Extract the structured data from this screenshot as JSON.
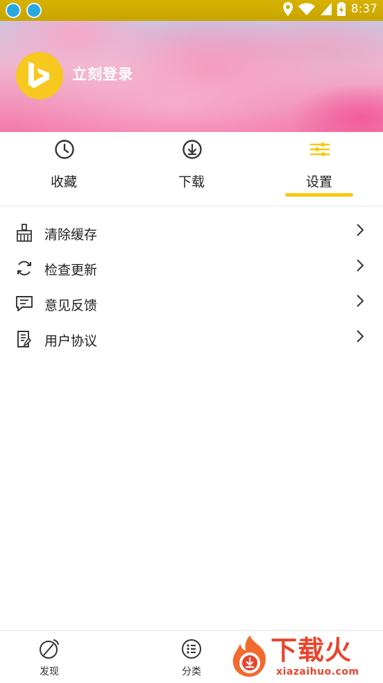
{
  "status_bar": {
    "time": "8:37",
    "left_icons": [
      "app-notification-icon",
      "app-notification-icon"
    ],
    "right_icons": [
      "location-icon",
      "wifi-icon",
      "signal-icon",
      "battery-charging-icon"
    ]
  },
  "header": {
    "avatar_icon": "bing-logo-icon",
    "login_label": "立刻登录"
  },
  "tabs": [
    {
      "label": "收藏",
      "icon": "clock-icon",
      "active": false
    },
    {
      "label": "下载",
      "icon": "download-icon",
      "active": false
    },
    {
      "label": "设置",
      "icon": "sliders-icon",
      "active": true
    }
  ],
  "settings": [
    {
      "label": "清除缓存",
      "icon": "broom-icon"
    },
    {
      "label": "检查更新",
      "icon": "refresh-icon"
    },
    {
      "label": "意见反馈",
      "icon": "feedback-icon"
    },
    {
      "label": "用户协议",
      "icon": "document-icon"
    }
  ],
  "bottom_nav": [
    {
      "label": "发现",
      "icon": "compass-icon"
    },
    {
      "label": "分类",
      "icon": "category-list-icon"
    }
  ],
  "watermark": {
    "title": "下载火",
    "url": "xiazaihuo.com"
  },
  "colors": {
    "accent": "#f6c90e",
    "status_bar": "#d7b200",
    "watermark": "#e8452c"
  }
}
